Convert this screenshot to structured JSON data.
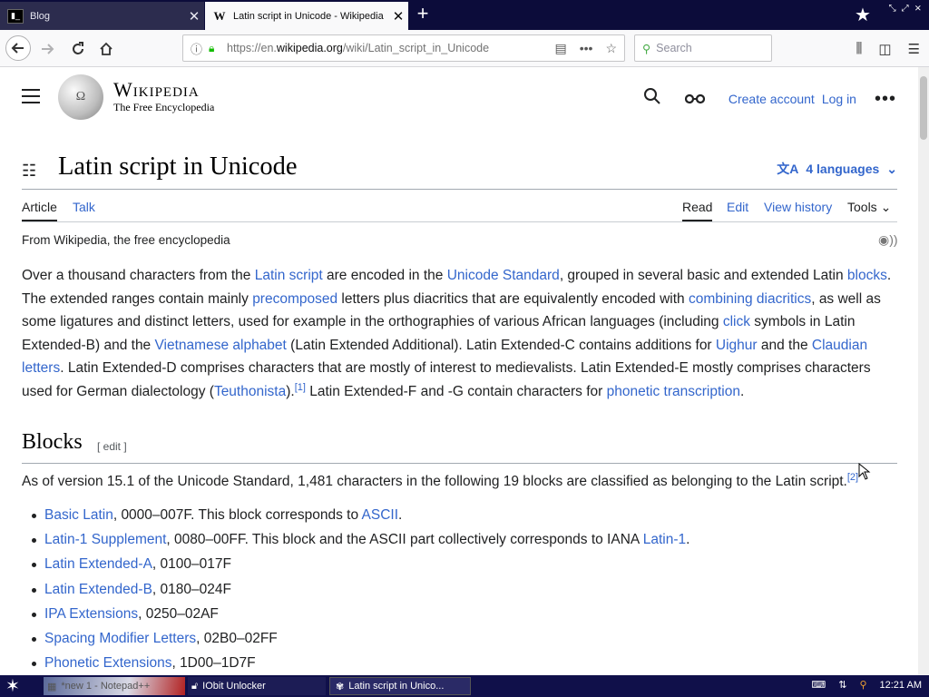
{
  "browser": {
    "tabs": [
      {
        "title": "Blog",
        "icon": "terminal-icon"
      },
      {
        "title": "Latin script in Unicode - Wikipedia",
        "icon": "wikipedia-w-icon"
      }
    ],
    "url_prefix": "https://en.",
    "url_domain": "wikipedia.org",
    "url_path": "/wiki/Latin_script_in_Unicode",
    "search_placeholder": "Search"
  },
  "wiki": {
    "wordmark_title": "Wikipedia",
    "wordmark_tagline": "The Free Encyclopedia",
    "create_account": "Create account",
    "log_in": "Log in",
    "page_title": "Latin script in Unicode",
    "languages": "4 languages",
    "tabs": {
      "article": "Article",
      "talk": "Talk",
      "read": "Read",
      "edit": "Edit",
      "history": "View history",
      "tools": "Tools"
    },
    "tagline": "From Wikipedia, the free encyclopedia",
    "intro": {
      "t1": "Over a thousand characters from the ",
      "l1": "Latin script",
      "t2": " are encoded in the ",
      "l2": "Unicode Standard",
      "t3": ", grouped in several basic and extended Latin ",
      "l3": "blocks",
      "t4": ". The extended ranges contain mainly ",
      "l4": "precomposed",
      "t5": " letters plus diacritics that are equivalently encoded with ",
      "l5": "combining diacritics",
      "t6": ", as well as some ligatures and distinct letters, used for example in the orthographies of various African languages (including ",
      "l6": "click",
      "t7": " symbols in Latin Extended-B) and the ",
      "l7": "Vietnamese alphabet",
      "t8": " (Latin Extended Additional). Latin Extended-C contains additions for ",
      "l8": "Uighur",
      "t9": " and the ",
      "l9": "Claudian letters",
      "t10": ". Latin Extended-D comprises characters that are mostly of interest to medievalists. Latin Extended-E mostly comprises characters used for German dialectology (",
      "l10": "Teuthonista",
      "t11": ").",
      "ref1": "[1]",
      "t12": " Latin Extended-F and -G contain characters for ",
      "l11": "phonetic transcription",
      "t13": "."
    },
    "blocks_heading": "Blocks",
    "edit_label": "[ edit ]",
    "blocks_para": "As of version 15.1 of the Unicode Standard, 1,481 characters in the following 19 blocks are classified as belonging to the Latin script.",
    "ref2": "[2]",
    "blocks": [
      {
        "name": "Basic Latin",
        "rest": ", 0000–007F. This block corresponds to ",
        "link2": "ASCII",
        "end": "."
      },
      {
        "name": "Latin-1 Supplement",
        "rest": ", 0080–00FF. This block and the ASCII part collectively corresponds to IANA ",
        "link2": "Latin-1",
        "end": "."
      },
      {
        "name": "Latin Extended-A",
        "rest": ", 0100–017F",
        "link2": "",
        "end": ""
      },
      {
        "name": "Latin Extended-B",
        "rest": ", 0180–024F",
        "link2": "",
        "end": ""
      },
      {
        "name": "IPA Extensions",
        "rest": ", 0250–02AF",
        "link2": "",
        "end": ""
      },
      {
        "name": "Spacing Modifier Letters",
        "rest": ", 02B0–02FF",
        "link2": "",
        "end": ""
      },
      {
        "name": "Phonetic Extensions",
        "rest": ", 1D00–1D7F",
        "link2": "",
        "end": ""
      }
    ]
  },
  "taskbar": {
    "task1": "*new 1 - Notepad++",
    "task2": "IObit Unlocker",
    "task3": "Latin script in Unico...",
    "clock": "12:21 AM"
  },
  "colors": {
    "link": "#3366cc",
    "text": "#202122",
    "tabbar": "#0c0c3a",
    "taskbar": "#10104a"
  }
}
